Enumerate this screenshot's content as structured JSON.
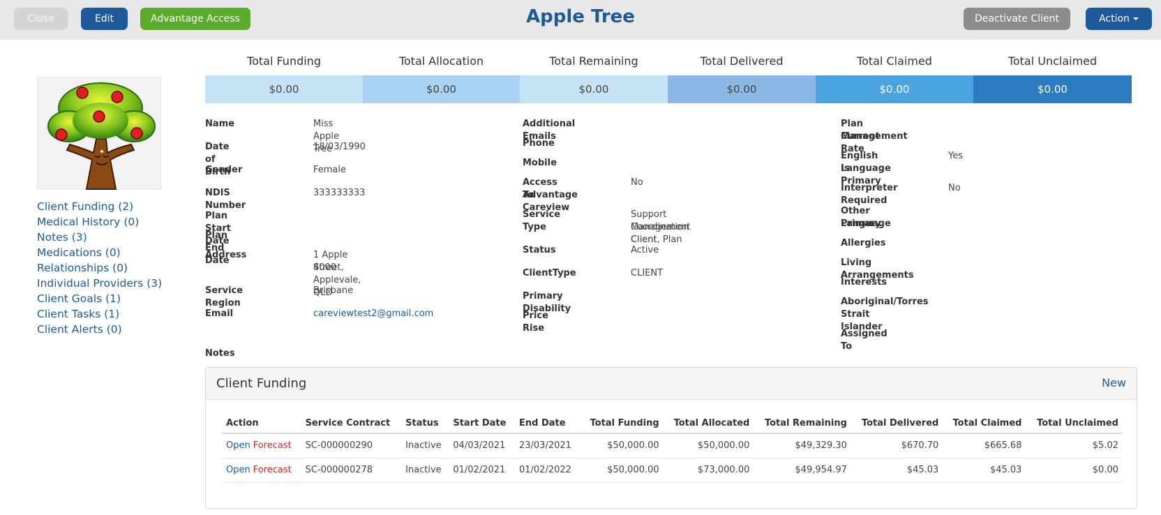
{
  "header": {
    "title": "Apple Tree",
    "close_label": "Close",
    "edit_label": "Edit",
    "advantage_label": "Advantage Access",
    "deactivate_label": "Deactivate Client",
    "action_label": "Action"
  },
  "side_links": [
    "Client Funding (2)",
    "Medical History (0)",
    "Notes (3)",
    "Medications (0)",
    "Relationships (0)",
    "Individual Providers (3)",
    "Client Goals (1)",
    "Client Tasks (1)",
    "Client Alerts (0)"
  ],
  "totals": [
    {
      "label": "Total Funding",
      "value": "$0.00",
      "bg": "#c6e2f7",
      "fg": "#444444"
    },
    {
      "label": "Total Allocation",
      "value": "$0.00",
      "bg": "#a9d3f2",
      "fg": "#444444"
    },
    {
      "label": "Total Remaining",
      "value": "$0.00",
      "bg": "#c6e2f7",
      "fg": "#444444"
    },
    {
      "label": "Total Delivered",
      "value": "$0.00",
      "bg": "#8bb8e4",
      "fg": "#444444"
    },
    {
      "label": "Total Claimed",
      "value": "$0.00",
      "bg": "#4aa3de",
      "fg": "#ffffff"
    },
    {
      "label": "Total Unclaimed",
      "value": "$0.00",
      "bg": "#2a7bbf",
      "fg": "#ffffff"
    }
  ],
  "details": {
    "col1": {
      "name_label": "Name",
      "name_value": "Miss Apple Tree",
      "dob_label": "Date of Birth",
      "dob_value": "18/03/1990",
      "gender_label": "Gender",
      "gender_value": "Female",
      "ndis_label": "NDIS Number",
      "ndis_value": "333333333",
      "plan_start_label": "Plan Start Date",
      "plan_end_label": "Plan End Date",
      "address_label": "Address",
      "address_line1": "1 Apple Street, Applevale, QLD",
      "address_line2": "4000",
      "region_label": "Service Region",
      "region_value": "Brisbane",
      "email_label": "Email",
      "email_value": "careviewtest2@gmail.com",
      "notes_label": "Notes"
    },
    "col2": {
      "additional_emails_label": "Additional Emails",
      "phone_label": "Phone",
      "mobile_label": "Mobile",
      "access_label_1": "Access To Careview",
      "access_label_2": "Advantage",
      "access_value": "No",
      "service_type_label": "Service Type",
      "service_type_line1": "Support Coordination Client, Plan",
      "service_type_line2": "Management Client",
      "status_label": "Status",
      "status_value": "Active",
      "client_type_label": "ClientType",
      "client_type_value": "CLIENT",
      "primary_disability_label": "Primary Disability",
      "price_rise_label": "Price Rise"
    },
    "col3": {
      "plan_mgmt_label_1": "Plan Management",
      "plan_mgmt_label_2": "Current Rate",
      "english_label_1": "English Is Primary",
      "english_label_2": "Language",
      "english_value": "Yes",
      "interpreter_label": "Interpreter Required",
      "interpreter_value": "No",
      "other_lang_label_1": "Other Primary",
      "other_lang_label_2": "Language",
      "allergies_label": "Allergies",
      "living_label": "Living Arrangements",
      "interests_label": "Interests",
      "aboriginal_label_1": "Aboriginal/Torres",
      "aboriginal_label_2": "Strait Islander",
      "assigned_label": "Assigned To"
    }
  },
  "funding": {
    "title": "Client Funding",
    "new_label": "New",
    "columns": [
      "Action",
      "Service Contract",
      "Status",
      "Start Date",
      "End Date",
      "Total Funding",
      "Total Allocated",
      "Total Remaining",
      "Total Delivered",
      "Total Claimed",
      "Total Unclaimed"
    ],
    "open_label": "Open",
    "forecast_label": "Forecast",
    "rows": [
      {
        "contract": "SC-000000290",
        "status": "Inactive",
        "start": "04/03/2021",
        "end": "23/03/2021",
        "funding": "$50,000.00",
        "allocated": "$50,000.00",
        "remaining": "$49,329.30",
        "delivered": "$670.70",
        "claimed": "$665.68",
        "unclaimed": "$5.02"
      },
      {
        "contract": "SC-000000278",
        "status": "Inactive",
        "start": "01/02/2021",
        "end": "01/02/2022",
        "funding": "$50,000.00",
        "allocated": "$73,000.00",
        "remaining": "$49,954.97",
        "delivered": "$45.03",
        "claimed": "$45.03",
        "unclaimed": "$0.00"
      }
    ]
  }
}
